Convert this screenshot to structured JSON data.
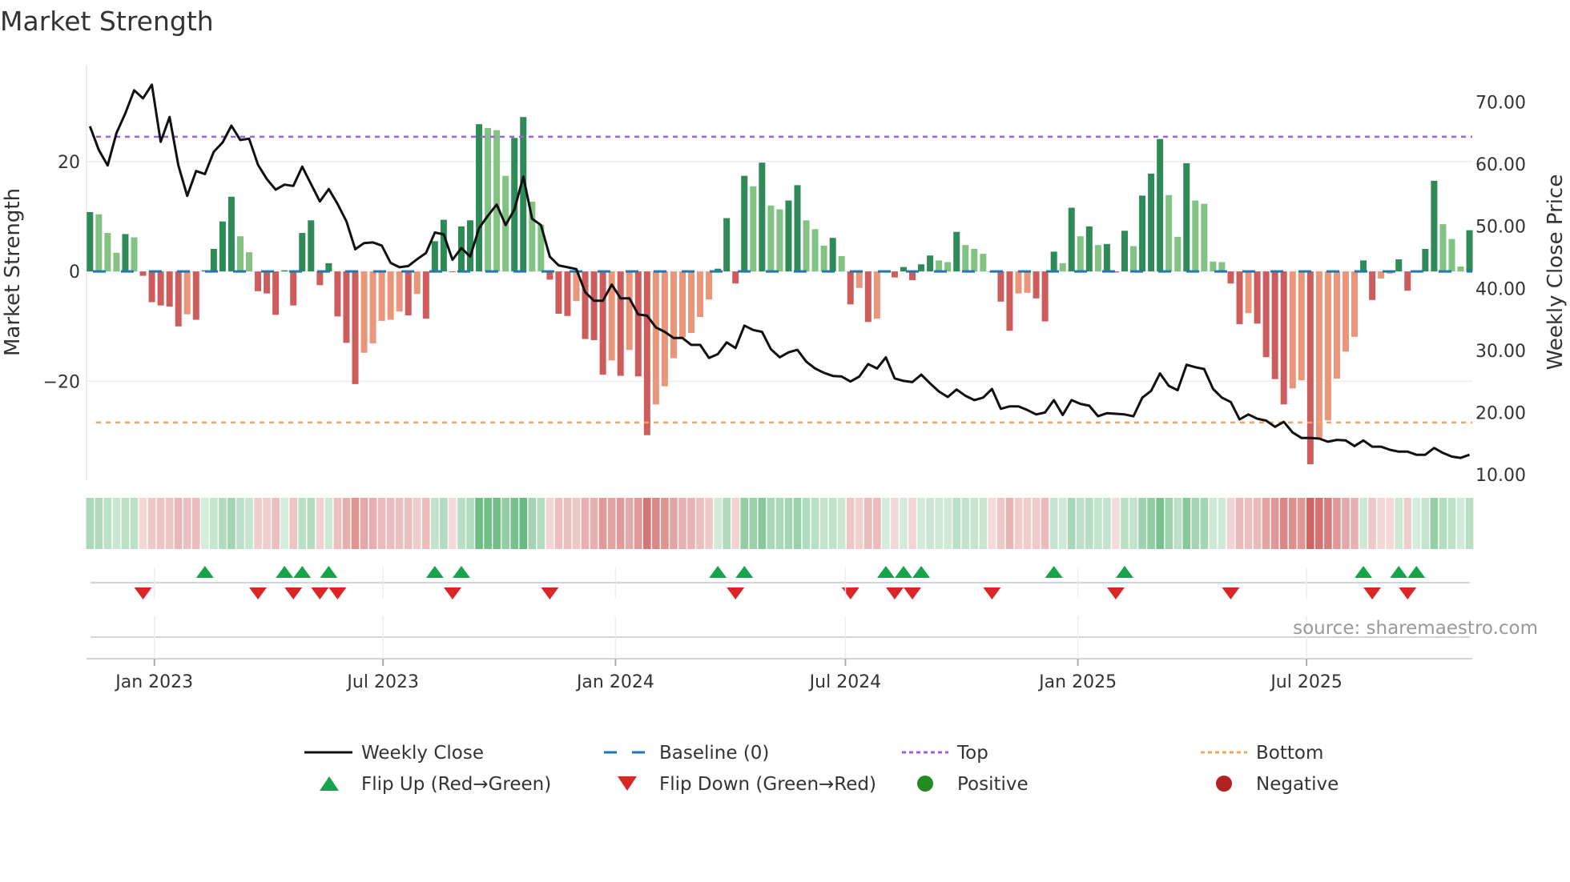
{
  "chart_data": {
    "type": "bar",
    "title": "Market Strength",
    "ylabel": "Market Strength",
    "y2label": "Weekly Close Price",
    "ylim": [
      -38,
      37.6
    ],
    "y2lim": [
      9.1,
      76.0
    ],
    "yticks": [
      {
        "v": 20,
        "label": "20"
      },
      {
        "v": 0,
        "label": "0"
      },
      {
        "v": -20,
        "label": "−20"
      }
    ],
    "y2ticks": [
      {
        "v": 70,
        "label": "70.00"
      },
      {
        "v": 60,
        "label": "60.00"
      },
      {
        "v": 50,
        "label": "50.00"
      },
      {
        "v": 40,
        "label": "40.00"
      },
      {
        "v": 30,
        "label": "30.00"
      },
      {
        "v": 20,
        "label": "20.00"
      },
      {
        "v": 10,
        "label": "10.00"
      }
    ],
    "xticks": [
      {
        "date": "2023-01-01",
        "label": "Jan 2023"
      },
      {
        "date": "2023-07-01",
        "label": "Jul 2023"
      },
      {
        "date": "2024-01-01",
        "label": "Jan 2024"
      },
      {
        "date": "2024-07-01",
        "label": "Jul 2024"
      },
      {
        "date": "2025-01-01",
        "label": "Jan 2025"
      },
      {
        "date": "2025-07-01",
        "label": "Jul 2025"
      }
    ],
    "x_start": "2022-11-11",
    "x_frequency": "weekly",
    "top_level": 24.5,
    "bottom_level": -27.5,
    "baseline": 0,
    "strength": [
      10.8,
      10.4,
      7.0,
      3.4,
      6.8,
      6.2,
      -0.8,
      -5.6,
      -6.2,
      -6.4,
      -10.0,
      -7.8,
      -8.8,
      0.2,
      4.1,
      9.1,
      13.6,
      6.4,
      3.5,
      -3.6,
      -4.0,
      -7.9,
      0.2,
      -6.2,
      7.0,
      9.3,
      -2.5,
      1.5,
      -8.2,
      -13.0,
      -20.5,
      -14.8,
      -13.1,
      -9.0,
      -8.8,
      -7.3,
      -8.0,
      -4.1,
      -8.6,
      5.5,
      9.4,
      -0.1,
      8.2,
      9.3,
      26.8,
      26.1,
      25.7,
      17.4,
      24.3,
      28.1,
      12.7,
      8.5,
      -1.5,
      -7.7,
      -8.1,
      -5.4,
      -12.3,
      -12.5,
      -18.8,
      -16.2,
      -19.0,
      -14.3,
      -19.1,
      -29.8,
      -24.2,
      -20.9,
      -15.8,
      -12.0,
      -11.2,
      -8.3,
      -5.1,
      0.5,
      9.7,
      -2.2,
      17.4,
      15.5,
      19.8,
      12.0,
      11.3,
      12.9,
      15.7,
      9.3,
      7.7,
      4.7,
      6.1,
      2.8,
      -6.0,
      -3.0,
      -9.2,
      -8.6,
      0.1,
      -1.1,
      0.8,
      -1.6,
      1.3,
      2.9,
      2.0,
      1.7,
      7.2,
      4.8,
      4.1,
      3.2,
      -0.1,
      -5.5,
      -10.8,
      -4.0,
      -3.9,
      -4.9,
      -9.1,
      3.6,
      1.5,
      11.6,
      6.4,
      8.2,
      4.8,
      5.0,
      -0.2,
      7.4,
      4.6,
      13.8,
      17.8,
      24.1,
      13.9,
      6.3,
      19.7,
      12.9,
      12.3,
      1.8,
      1.7,
      -2.2,
      -9.6,
      -7.6,
      -9.5,
      -15.6,
      -19.6,
      -24.2,
      -21.3,
      -19.8,
      -35.1,
      -30.5,
      -27.1,
      -19.5,
      -14.6,
      -11.9,
      2.0,
      -5.2,
      -1.3,
      -0.4,
      2.2,
      -3.5,
      0.1,
      4.1,
      16.5,
      8.6,
      5.9,
      0.9,
      7.5
    ],
    "weekly_close": [
      66.1,
      62.3,
      59.8,
      65.0,
      68.2,
      71.9,
      70.6,
      72.8,
      63.6,
      67.6,
      59.8,
      54.9,
      58.9,
      58.4,
      62.0,
      63.5,
      66.2,
      63.9,
      64.1,
      59.9,
      57.6,
      55.9,
      56.7,
      56.5,
      59.6,
      56.8,
      54.0,
      56.0,
      53.6,
      50.8,
      46.3,
      47.3,
      47.4,
      46.9,
      44.1,
      43.4,
      43.6,
      44.7,
      45.7,
      49.0,
      48.7,
      44.6,
      46.5,
      45.1,
      49.7,
      51.7,
      53.5,
      50.2,
      52.7,
      58.0,
      51.2,
      50.2,
      45.1,
      43.7,
      43.4,
      43.1,
      39.4,
      38.0,
      38.0,
      40.6,
      38.4,
      38.4,
      35.8,
      35.6,
      33.7,
      33.0,
      32.0,
      32.0,
      30.9,
      30.9,
      28.8,
      29.4,
      31.3,
      30.4,
      34.0,
      33.3,
      33.0,
      30.2,
      28.9,
      29.7,
      30.1,
      28.2,
      27.1,
      26.4,
      25.9,
      25.8,
      25.0,
      25.8,
      27.8,
      27.1,
      28.9,
      25.5,
      25.1,
      24.9,
      26.1,
      24.7,
      23.4,
      22.5,
      23.7,
      22.7,
      22.0,
      22.4,
      23.8,
      20.6,
      21.0,
      21.0,
      20.4,
      19.7,
      20.0,
      22.0,
      19.6,
      22.0,
      21.4,
      21.1,
      19.4,
      19.9,
      19.8,
      19.7,
      19.4,
      22.4,
      23.5,
      26.3,
      24.3,
      23.6,
      27.7,
      27.3,
      27.0,
      23.8,
      22.4,
      21.7,
      18.9,
      19.7,
      19.0,
      18.7,
      17.7,
      18.5,
      16.8,
      15.9,
      15.9,
      15.8,
      15.3,
      15.6,
      15.5,
      14.6,
      15.5,
      14.5,
      14.5,
      14.0,
      13.7,
      13.7,
      13.2,
      13.2,
      14.3,
      13.5,
      12.9,
      12.7,
      13.2
    ],
    "legend": {
      "placement": "bottom",
      "items": [
        {
          "label": "Weekly Close",
          "kind": "line"
        },
        {
          "label": "Baseline (0)",
          "kind": "dash"
        },
        {
          "label": "Top",
          "kind": "dot-purple"
        },
        {
          "label": "Bottom",
          "kind": "dot-orange"
        },
        {
          "label": "Flip Up (Red→Green)",
          "kind": "tri-up"
        },
        {
          "label": "Flip Down (Green→Red)",
          "kind": "tri-down"
        },
        {
          "label": "Positive",
          "kind": "circle-green"
        },
        {
          "label": "Negative",
          "kind": "circle-red"
        }
      ]
    },
    "source": "source: sharemaestro.com",
    "colors": {
      "pos_up": "#2e8b57",
      "pos_down": "#82c282",
      "neg_down": "#cd5c5c",
      "neg_up": "#e9967a",
      "line": "#111111",
      "baseline": "#1f77b4",
      "top": "#a35ddf",
      "bottom": "#f4a460",
      "flip_up": "#16a34a",
      "flip_down": "#dc2626",
      "positive": "#228b22",
      "negative": "#b22222"
    }
  }
}
